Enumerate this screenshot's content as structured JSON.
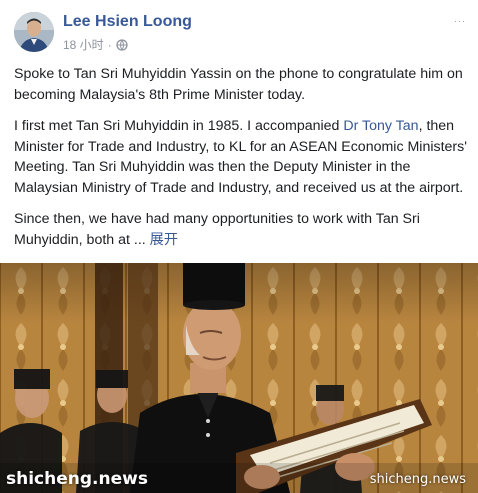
{
  "post": {
    "author": "Lee Hsien Loong",
    "time": "18 小时",
    "more_label": "···",
    "paragraphs": {
      "p1": "Spoke to Tan Sri Muhyiddin Yassin on the phone to congratulate him on becoming Malaysia's 8th Prime Minister today.",
      "p2_before": "I first met Tan Sri Muhyiddin in 1985. I accompanied ",
      "p2_link": "Dr Tony Tan",
      "p2_after": ", then Minister for Trade and Industry, to KL for an ASEAN Economic Ministers' Meeting. Tan Sri Muhyiddin was then the Deputy Minister in the Malaysian Ministry of Trade and Industry, and received us at the airport.",
      "p3": "Since then, we have had many opportunities to work with Tan Sri Muhyiddin, both at ... ",
      "see_more": "展开"
    }
  },
  "photo": {
    "icon": "photo",
    "watermark_left": "shicheng.news",
    "watermark_right": "shicheng.news"
  },
  "colors": {
    "link": "#385898",
    "meta": "#8d949e",
    "text": "#1c1e21",
    "wallpaper": "#b8853f"
  }
}
